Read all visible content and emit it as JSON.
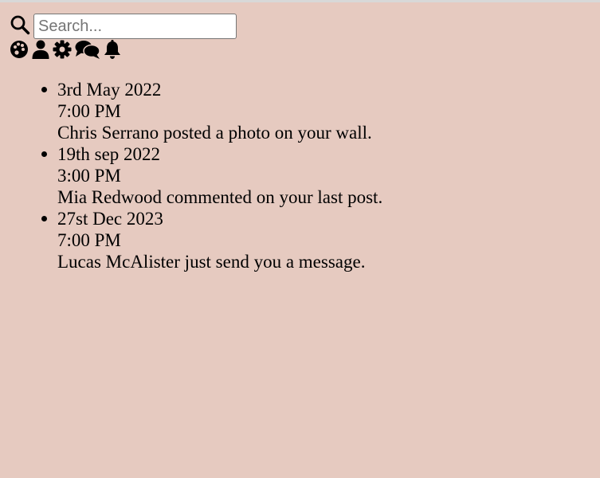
{
  "search": {
    "placeholder": "Search...",
    "value": ""
  },
  "toolbar": {
    "icons": [
      "palette-icon",
      "user-icon",
      "gear-icon",
      "comments-icon",
      "bell-icon"
    ]
  },
  "notifications": [
    {
      "date": "3rd May 2022",
      "time": "7:00 PM",
      "message": "Chris Serrano posted a photo on your wall."
    },
    {
      "date": "19th sep 2022",
      "time": "3:00 PM",
      "message": "Mia Redwood commented on your last post."
    },
    {
      "date": "27st Dec 2023",
      "time": "7:00 PM",
      "message": "Lucas McAlister just send you a message."
    }
  ],
  "colors": {
    "background": "#e6cac0",
    "text": "#000000"
  }
}
